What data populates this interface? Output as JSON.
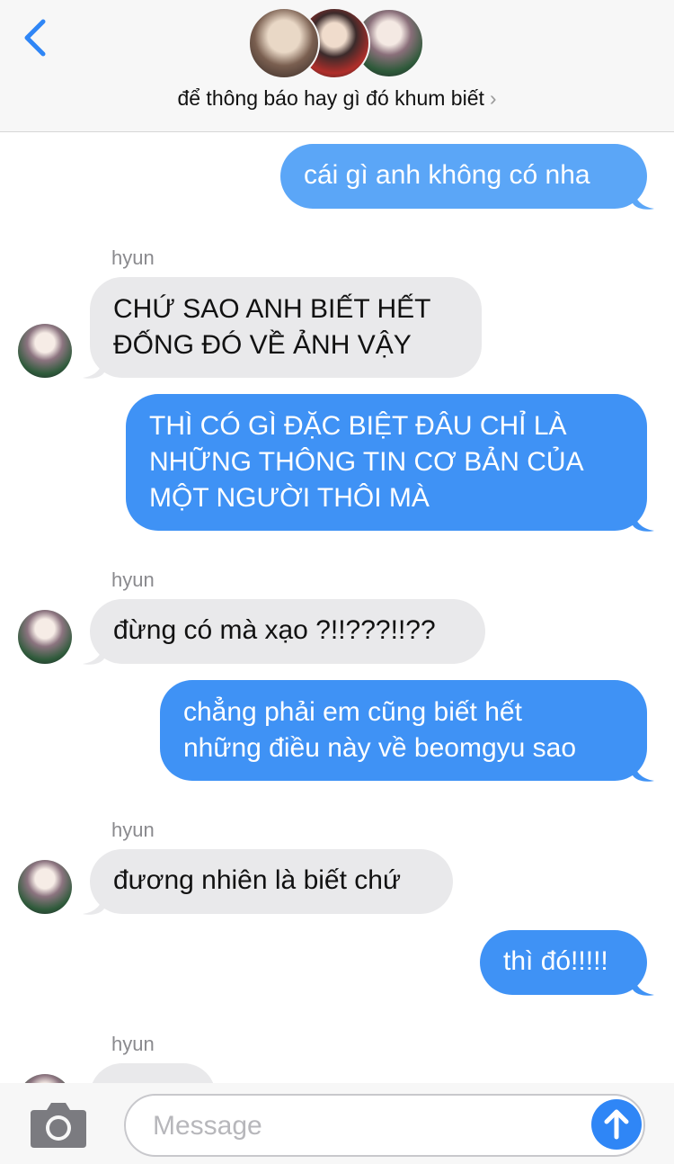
{
  "header": {
    "title": "để thông báo hay gì đó khum biết",
    "chevron": "›"
  },
  "messages": [
    {
      "kind": "out",
      "text": "cái gì anh không có nha"
    },
    {
      "kind": "in",
      "sender": "hyun",
      "lines": [
        "CHỨ SAO ANH BIẾT HẾT",
        "ĐỐNG ĐÓ VỀ ẢNH VẬY"
      ]
    },
    {
      "kind": "out",
      "lines": [
        "THÌ CÓ GÌ ĐẶC BIỆT ĐÂU CHỈ LÀ",
        "NHỮNG THÔNG TIN CƠ BẢN CỦA",
        "MỘT NGƯỜI THÔI MÀ"
      ]
    },
    {
      "kind": "in",
      "sender": "hyun",
      "text": "đừng có mà xạo ?!!???!!??"
    },
    {
      "kind": "out",
      "lines": [
        "chẳng phải em cũng biết hết",
        "những điều này về beomgyu sao"
      ]
    },
    {
      "kind": "in",
      "sender": "hyun",
      "text": "đương nhiên là biết chứ"
    },
    {
      "kind": "out",
      "text": "thì đó!!!!!"
    },
    {
      "kind": "in",
      "sender": "hyun",
      "text": ""
    }
  ],
  "composer": {
    "placeholder": "Message"
  },
  "colors": {
    "outgoing": "#3f92f5",
    "incoming": "#e9e9eb",
    "accent": "#2f86f6"
  },
  "icons": [
    "back-chevron-icon",
    "camera-icon",
    "send-arrow-icon"
  ]
}
